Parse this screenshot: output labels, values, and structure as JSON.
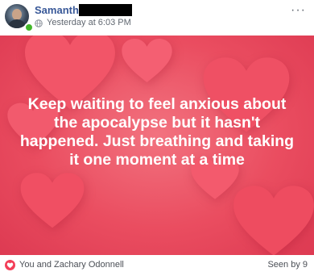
{
  "post": {
    "author_name": "Samantha",
    "timestamp": "Yesterday at 6:03 PM",
    "text": "Keep waiting to feel anxious about the apocalypse but it hasn't happened. Just breathing and taking it one moment at a time",
    "background_color": "#ea4d60",
    "heart_color": "#f25568"
  },
  "icons": {
    "privacy": "globe-icon",
    "reaction": "love-reaction-icon",
    "presence": "online-status-dot"
  },
  "footer": {
    "reactions_text": "You and Zachary Odonnell",
    "seen_text": "Seen by 9"
  }
}
